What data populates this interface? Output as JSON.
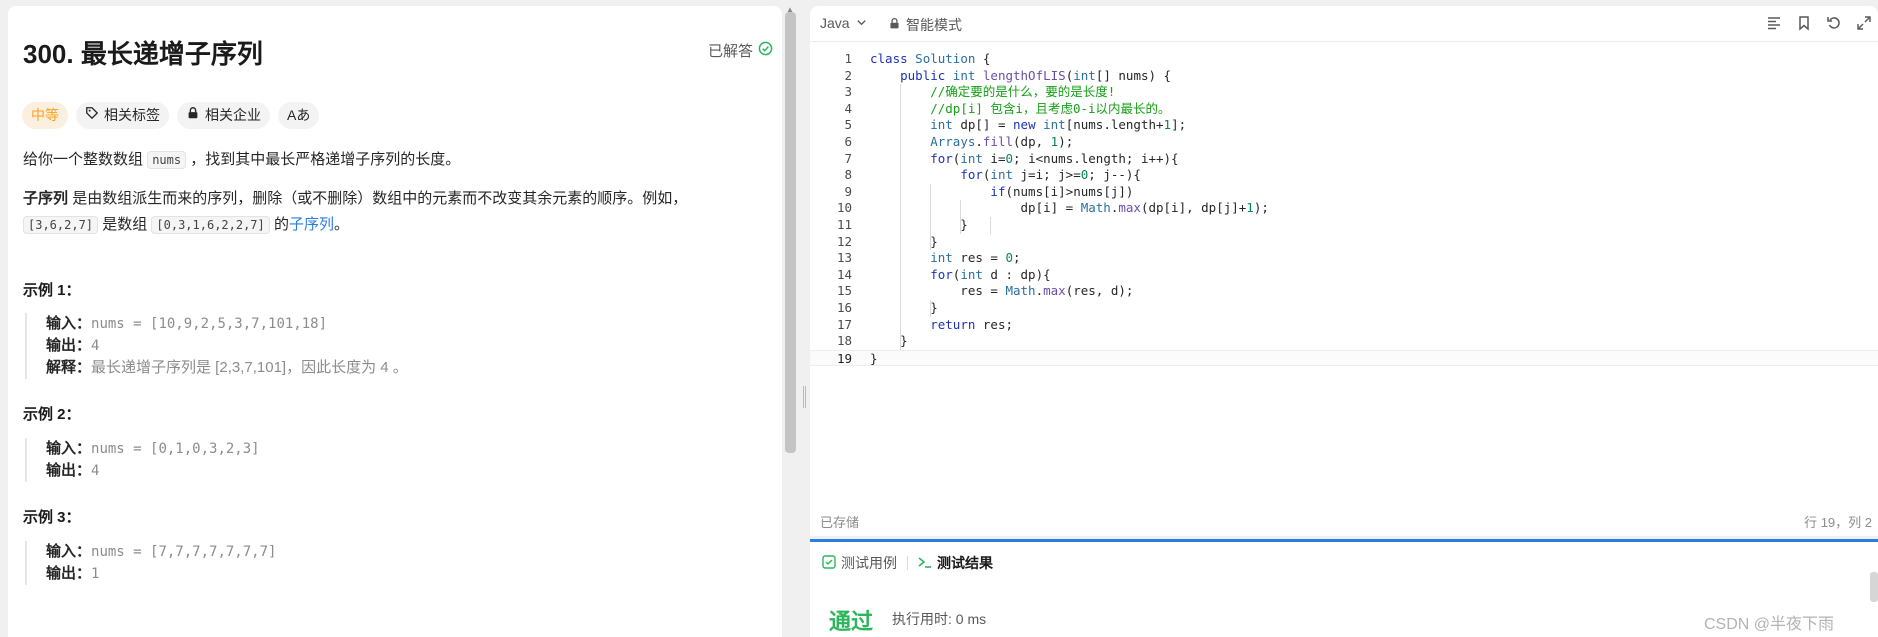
{
  "problem": {
    "title": "300. 最长递增子序列",
    "solved_label": "已解答",
    "tags": {
      "difficulty": "中等",
      "topics": "相关标签",
      "companies": "相关企业",
      "font": "Aあ"
    },
    "desc_intro": "给你一个整数数组",
    "desc_var": "nums",
    "desc_rest": "，找到其中最长严格递增子序列的长度。",
    "def_bold": "子序列",
    "def_text": "是由数组派生而来的序列，删除（或不删除）数组中的元素而不改变其余元素的顺序。例如，",
    "def_ex1": "[3,6,2,7]",
    "def_mid": "是数组",
    "def_ex2": "[0,3,1,6,2,2,7]",
    "def_of": "的",
    "def_link": "子序列",
    "def_end": "。",
    "examples": [
      {
        "title": "示例 1：",
        "input_label": "输入：",
        "input": "nums = [10,9,2,5,3,7,101,18]",
        "output_label": "输出：",
        "output": "4",
        "explain_label": "解释：",
        "explain": "最长递增子序列是 [2,3,7,101]，因此长度为 4 。"
      },
      {
        "title": "示例 2：",
        "input_label": "输入：",
        "input": "nums = [0,1,0,3,2,3]",
        "output_label": "输出：",
        "output": "4"
      },
      {
        "title": "示例 3：",
        "input_label": "输入：",
        "input": "nums = [7,7,7,7,7,7,7]",
        "output_label": "输出：",
        "output": "1"
      }
    ]
  },
  "editor": {
    "language": "Java",
    "mode": "智能模式",
    "saved": "已存储",
    "cursor": "行 19，列 2",
    "current_line": 19,
    "code_lines": [
      "class Solution {",
      "    public int lengthOfLIS(int[] nums) {",
      "        //确定要的是什么，要的是长度!",
      "        //dp[i] 包含i，且考虑0-i以内最长的。",
      "        int dp[] = new int[nums.length+1];",
      "        Arrays.fill(dp, 1);",
      "        for(int i=0; i<nums.length; i++){",
      "            for(int j=i; j>=0; j--){",
      "                if(nums[i]>nums[j])",
      "                    dp[i] = Math.max(dp[i], dp[j]+1);",
      "            }",
      "        }",
      "        int res = 0;",
      "        for(int d : dp){",
      "            res = Math.max(res, d);",
      "        }",
      "        return res;",
      "    }",
      "}"
    ]
  },
  "console": {
    "tab_testcase": "测试用例",
    "tab_result": "测试结果",
    "status": "通过",
    "runtime": "执行用时: 0 ms",
    "watermark": "CSDN @半夜下雨"
  },
  "colors": {
    "accent": "#2a7de1",
    "pass": "#2db55d",
    "difficulty": "#ffa116",
    "solved": "#2db55d"
  }
}
